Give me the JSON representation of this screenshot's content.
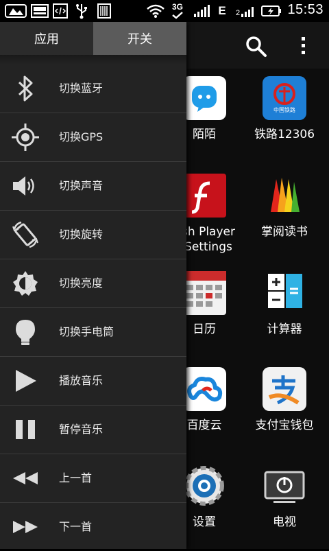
{
  "status_bar": {
    "time": "15:53",
    "network_type": "3G",
    "network_letter": "E",
    "icons": [
      "wechat-icon",
      "image-icon",
      "code-icon",
      "usb-icon",
      "barcode-icon",
      "wifi-icon",
      "signal-icon",
      "battery-icon"
    ]
  },
  "drawer": {
    "tabs": [
      {
        "label": "应用",
        "active": false
      },
      {
        "label": "开关",
        "active": true
      }
    ],
    "items": [
      {
        "label": "切换蓝牙",
        "icon": "bluetooth-icon"
      },
      {
        "label": "切换GPS",
        "icon": "gps-icon"
      },
      {
        "label": "切换声音",
        "icon": "volume-icon"
      },
      {
        "label": "切换旋转",
        "icon": "rotate-icon"
      },
      {
        "label": "切换亮度",
        "icon": "brightness-icon"
      },
      {
        "label": "切换手电筒",
        "icon": "flashlight-icon"
      },
      {
        "label": "播放音乐",
        "icon": "play-icon"
      },
      {
        "label": "暂停音乐",
        "icon": "pause-icon"
      },
      {
        "label": "上一首",
        "icon": "previous-icon"
      },
      {
        "label": "下一首",
        "icon": "next-icon"
      }
    ]
  },
  "apps": [
    {
      "label": "陌陌"
    },
    {
      "label": "铁路12306",
      "icon_text": "中国铁路"
    },
    {
      "label": "sh Player\nSettings"
    },
    {
      "label": "掌阅读书"
    },
    {
      "label": "日历"
    },
    {
      "label": "计算器"
    },
    {
      "label": "百度云"
    },
    {
      "label": "支付宝钱包"
    },
    {
      "label": "设置"
    },
    {
      "label": "电视"
    }
  ],
  "colors": {
    "accent": "#1f87e6",
    "tab_active": "#5b5b5b",
    "drawer_bg": "#232323"
  }
}
